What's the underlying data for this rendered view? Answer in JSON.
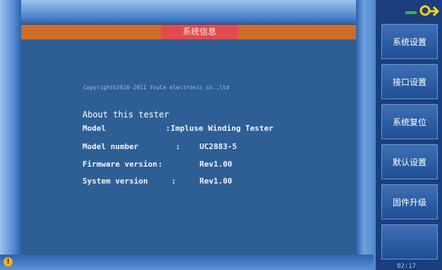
{
  "title": "系统信息",
  "copyright": "Copyright©2010-2011 YouCe electronic co.,ltd",
  "about_heading": "About this tester",
  "info": [
    {
      "label": "Model",
      "sep": ":",
      "value": "Impluse Winding Tester"
    },
    {
      "label": "Model number",
      "sep": ":",
      "value": "UC2883-5"
    },
    {
      "label": "Firmware version",
      "sep": ":",
      "value": "Rev1.00"
    },
    {
      "label": "System version",
      "sep": ":",
      "value": "Rev1.00"
    }
  ],
  "menu": [
    {
      "label": "系统设置"
    },
    {
      "label": "接口设置"
    },
    {
      "label": "系统复位"
    },
    {
      "label": "默认设置"
    },
    {
      "label": "固件升级"
    },
    {
      "label": ""
    }
  ],
  "status_time": "02:17",
  "colors": {
    "background": "#1c3f7a",
    "content": "#2e5f94",
    "title_bar": "#cc6e28",
    "title_highlight": "#e24b4b",
    "status_icon": "#ffd21a",
    "info_icon": "#f2b21b"
  },
  "icons": [
    "usb-lock-icon",
    "info-icon"
  ]
}
